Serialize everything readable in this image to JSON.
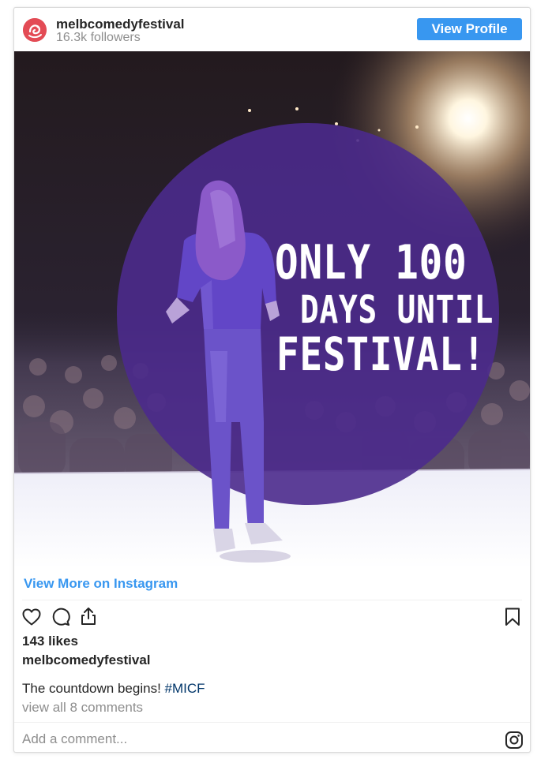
{
  "post": {
    "username": "melbcomedyfestival",
    "followers": "16.3k followers",
    "view_profile_label": "View Profile",
    "image": {
      "headline_line1": "ONLY 100",
      "headline_line2": "DAYS UNTIL",
      "headline_line3": "FESTIVAL!"
    },
    "view_more_label": "View More on Instagram",
    "likes": "143 likes",
    "caption_username": "melbcomedyfestival",
    "caption_text": "The countdown begins! ",
    "caption_hashtag": "#MICF",
    "view_comments": "view all 8 comments",
    "comment_placeholder": "Add a comment..."
  },
  "icons": {
    "like": "heart-icon",
    "comment": "comment-icon",
    "share": "share-icon",
    "save": "bookmark-icon",
    "instagram": "instagram-icon"
  },
  "colors": {
    "accent": "#3897f0",
    "hashtag": "#003569",
    "muted": "#8e8e8e",
    "circle": "#4b2a8c",
    "avatar": "#e34b55"
  }
}
